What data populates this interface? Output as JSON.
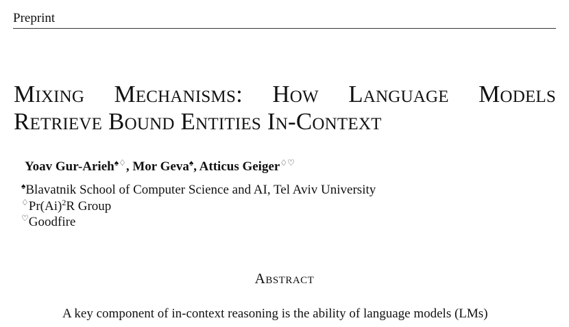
{
  "header": {
    "label": "Preprint"
  },
  "title": {
    "line1": "Mixing Mechanisms:  How Language Models",
    "line2": "Retrieve Bound Entities In-Context"
  },
  "authors": [
    {
      "name": "Yoav Gur-Arieh",
      "marks": "♠♢"
    },
    {
      "name": "Mor Geva",
      "marks": "♠"
    },
    {
      "name": "Atticus Geiger",
      "marks": "♢♡"
    }
  ],
  "author_separator": ", ",
  "affiliations": [
    {
      "mark": "♠",
      "text": "Blavatnik School of Computer Science and AI, Tel Aviv University"
    },
    {
      "mark": "♢",
      "text_before": "Pr(Ai)",
      "sup": "2",
      "text_after": "R Group"
    },
    {
      "mark": "♡",
      "text": "Goodfire"
    }
  ],
  "abstract": {
    "heading": "Abstract",
    "first_line": "A key component of in-context reasoning is the ability of language models (LMs)"
  }
}
